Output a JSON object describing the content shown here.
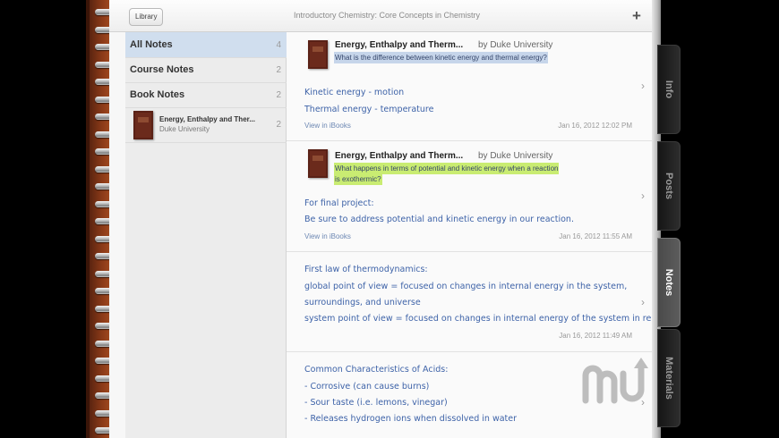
{
  "toolbar": {
    "library_label": "Library",
    "book_title": "Introductory Chemistry: Core Concepts in Chemistry",
    "add_label": "+"
  },
  "sidebar": {
    "items": [
      {
        "label": "All Notes",
        "count": "4"
      },
      {
        "label": "Course Notes",
        "count": "2"
      },
      {
        "label": "Book Notes",
        "count": "2"
      }
    ],
    "book": {
      "title": "Energy, Enthalpy and Ther...",
      "author": "Duke University",
      "count": "2"
    }
  },
  "notes": [
    {
      "book_title": "Energy, Enthalpy and Therm...",
      "by": "by Duke University",
      "highlight": [
        "What is the difference between kinetic energy and thermal energy?"
      ],
      "highlight_color": "#c6d5ea",
      "lines": [
        "Kinetic energy - motion",
        "Thermal energy - temperature"
      ],
      "view_link": "View in iBooks",
      "date": "Jan 16, 2012 12:02 PM"
    },
    {
      "book_title": "Energy, Enthalpy and Therm...",
      "by": "by Duke University",
      "highlight": [
        "What happens in terms of potential and kinetic energy when a reaction",
        "is exothermic?"
      ],
      "highlight_color": "#c9ec72",
      "lines": [
        "For final project:",
        "Be sure to address potential and kinetic energy in our reaction."
      ],
      "view_link": "View in iBooks",
      "date": "Jan 16, 2012 11:55 AM"
    },
    {
      "lines": [
        "First law of thermodynamics:",
        "global point of view = focused on changes in internal energy in the system,",
        "surroundings, and universe",
        "system point of view = focused on changes in internal energy of the system in rela..."
      ],
      "date": "Jan 16, 2012 11:49 AM"
    },
    {
      "lines": [
        "Common Characteristics of Acids:",
        "- Corrosive (can cause burns)",
        "- Sour taste (i.e. lemons, vinegar)",
        "- Releases hydrogen ions when dissolved in water"
      ]
    }
  ],
  "tabs": [
    {
      "label": "Info",
      "active": false
    },
    {
      "label": "Posts",
      "active": false
    },
    {
      "label": "Notes",
      "active": true
    },
    {
      "label": "Materials",
      "active": false
    }
  ],
  "icons": {
    "chevron": "chevron-right-icon",
    "add": "plus-icon",
    "watermark": "macupdate-logo"
  }
}
